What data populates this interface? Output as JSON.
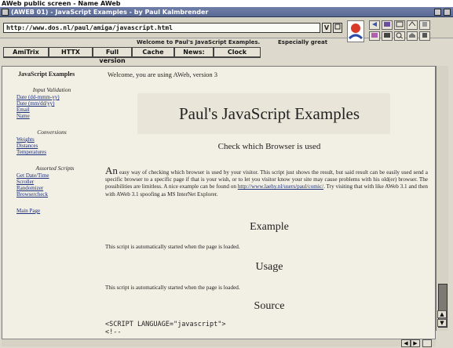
{
  "screen": {
    "title": "AWeb public screen - Name AWeb"
  },
  "window": {
    "title": "(AWEB 01) - JavaScript Examples - by Paul Kalmbrender"
  },
  "toolbar": {
    "url": "http://www.dos.nl/paul/amiga/javascript.html",
    "url_dropdown_glyph": "V",
    "status_message": "Welcome to Paul's JavaScript Examples.",
    "location_text": "Especially great"
  },
  "nav_buttons": [
    "AmiTrix",
    "HTTX",
    "Full version",
    "Cache",
    "News:",
    "Clock"
  ],
  "sidebar": {
    "title": "JavaScript Examples",
    "sections": [
      {
        "heading": "Input Validation",
        "links": [
          "Date (dd-mmm-yy)",
          "Date (mm/dd/yy)",
          "Email",
          "Name"
        ]
      },
      {
        "heading": "Conversions",
        "links": [
          "Weights",
          "Distances",
          "Temperatures"
        ]
      },
      {
        "heading": "Assorted Scripts",
        "links": [
          "Get Date/Time",
          "Scroller",
          "Randomizer",
          "Browsercheck"
        ]
      }
    ],
    "main_page": "Main Page"
  },
  "main": {
    "welcome": "Welcome, you are using AWeb, version 3",
    "page_title": "Paul's JavaScript Examples",
    "subtitle": "Check which Browser is used",
    "paragraph_start": "An",
    "paragraph_body": " easy way of checking which browser is used by your visitor. This script just shows the result, but said result can be easily used send a specific browser to a specific page if that is your wish, or to let you visitor know your site may cause problems with his old(er) browser. The possibilities are limitless. A nice example can be found on ",
    "paragraph_link": "http://www.laehy.nl/users/paul/comic/",
    "paragraph_end": ". Try visiting that with like AWeb 3.1 and then with AWeb 3.1 spoofing as MS InterNet Explorer.",
    "example_heading": "Example",
    "example_text": "This script is automatically started when the page is loaded.",
    "usage_heading": "Usage",
    "usage_text": "This script is automatically started when the page is loaded.",
    "source_heading": "Source",
    "code_line1": "<SCRIPT LANGUAGE=\"javascript\">",
    "code_line2": "<!--"
  }
}
